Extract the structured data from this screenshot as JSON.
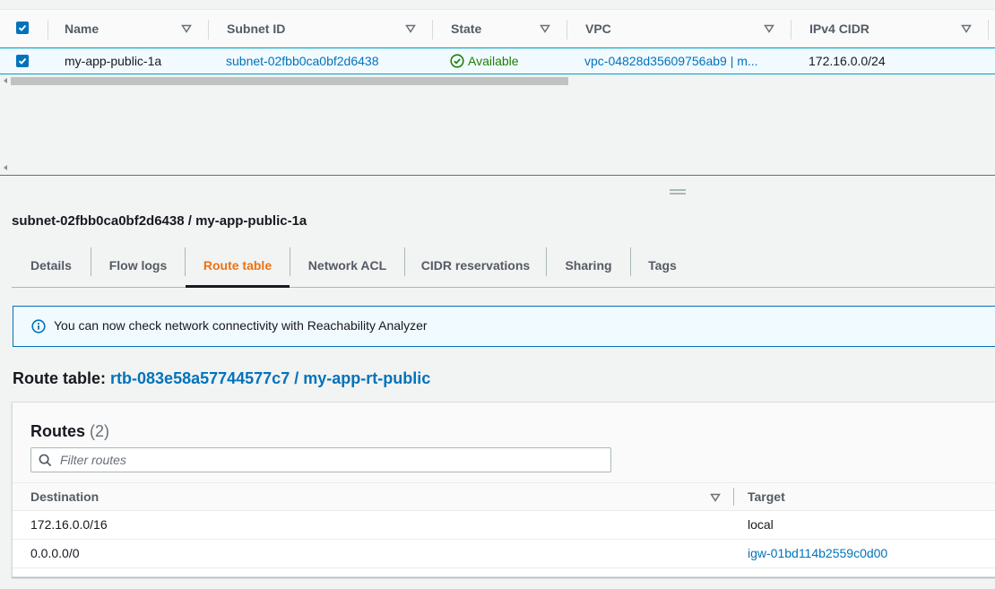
{
  "table": {
    "columns": {
      "name": "Name",
      "subnet_id": "Subnet ID",
      "state": "State",
      "vpc": "VPC",
      "ipv4_cidr": "IPv4 CIDR"
    },
    "row": {
      "name": "my-app-public-1a",
      "subnet_id": "subnet-02fbb0ca0bf2d6438",
      "state": "Available",
      "vpc": "vpc-04828d35609756ab9 | m...",
      "ipv4_cidr": "172.16.0.0/24"
    }
  },
  "panel": {
    "title": "subnet-02fbb0ca0bf2d6438 / my-app-public-1a",
    "tabs": [
      "Details",
      "Flow logs",
      "Route table",
      "Network ACL",
      "CIDR reservations",
      "Sharing",
      "Tags"
    ],
    "active_tab": "Route table",
    "info_banner": "You can now check network connectivity with Reachability Analyzer",
    "route_table_label": "Route table:",
    "route_table_link": "rtb-083e58a57744577c7 / my-app-rt-public",
    "routes": {
      "title": "Routes",
      "count": "(2)",
      "filter_placeholder": "Filter routes",
      "columns": {
        "destination": "Destination",
        "target": "Target"
      },
      "rows": [
        {
          "destination": "172.16.0.0/16",
          "target": "local"
        },
        {
          "destination": "0.0.0.0/0",
          "target": "igw-01bd114b2559c0d00"
        }
      ]
    }
  },
  "colors": {
    "link": "#0073bb",
    "active_tab": "#ec7211",
    "available": "#1d8102",
    "selection_bg": "#f1faff"
  },
  "icons": [
    "checkbox-checked-icon",
    "sort-caret-icon",
    "status-available-icon",
    "info-icon",
    "search-icon",
    "drag-handle-icon"
  ]
}
